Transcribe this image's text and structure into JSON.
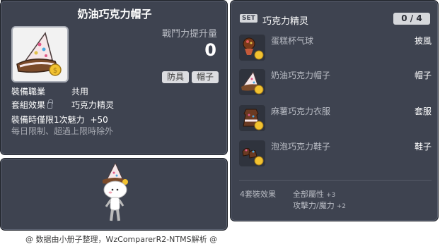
{
  "item": {
    "id": "01003460",
    "name": "奶油巧克力帽子",
    "stat_label": "戰鬥力提升量",
    "stat_value": "0",
    "tags": [
      "防具",
      "帽子"
    ],
    "job_label": "裝備職業",
    "job_value": "共用",
    "set_label": "套組效果",
    "set_value": "巧克力精灵",
    "limit_text": "裝備時僅限1次魅力",
    "limit_value": "+50",
    "daily_text": "每日限制、超過上限時除外"
  },
  "set": {
    "badge": "SET",
    "name": "巧克力精灵",
    "count": "0 / 4",
    "items": [
      {
        "name": "蛋糕杯气球",
        "type": "披風"
      },
      {
        "name": "奶油巧克力帽子",
        "type": "帽子"
      },
      {
        "name": "麻薯巧克力衣服",
        "type": "套服"
      },
      {
        "name": "泡泡巧克力鞋子",
        "type": "鞋子"
      }
    ],
    "bonus_count": "4套裝效果",
    "bonuses": [
      {
        "label": "全部屬性",
        "value": "+3"
      },
      {
        "label": "攻擊力/魔力",
        "value": "+2"
      }
    ]
  },
  "footer": "@ 数据由小册子整理，WzComparerR2-NTMS解析 @",
  "colors": {
    "panel_bg": "#3e4350",
    "panel_border": "#1c1f26",
    "text_primary": "#ffffff",
    "text_secondary": "#b9bcc4",
    "tag_bg": "#dcdde1"
  },
  "icons": [
    "hat-icon",
    "lock-icon",
    "balloon-icon",
    "dress-icon",
    "shoes-icon",
    "coin-icon"
  ]
}
